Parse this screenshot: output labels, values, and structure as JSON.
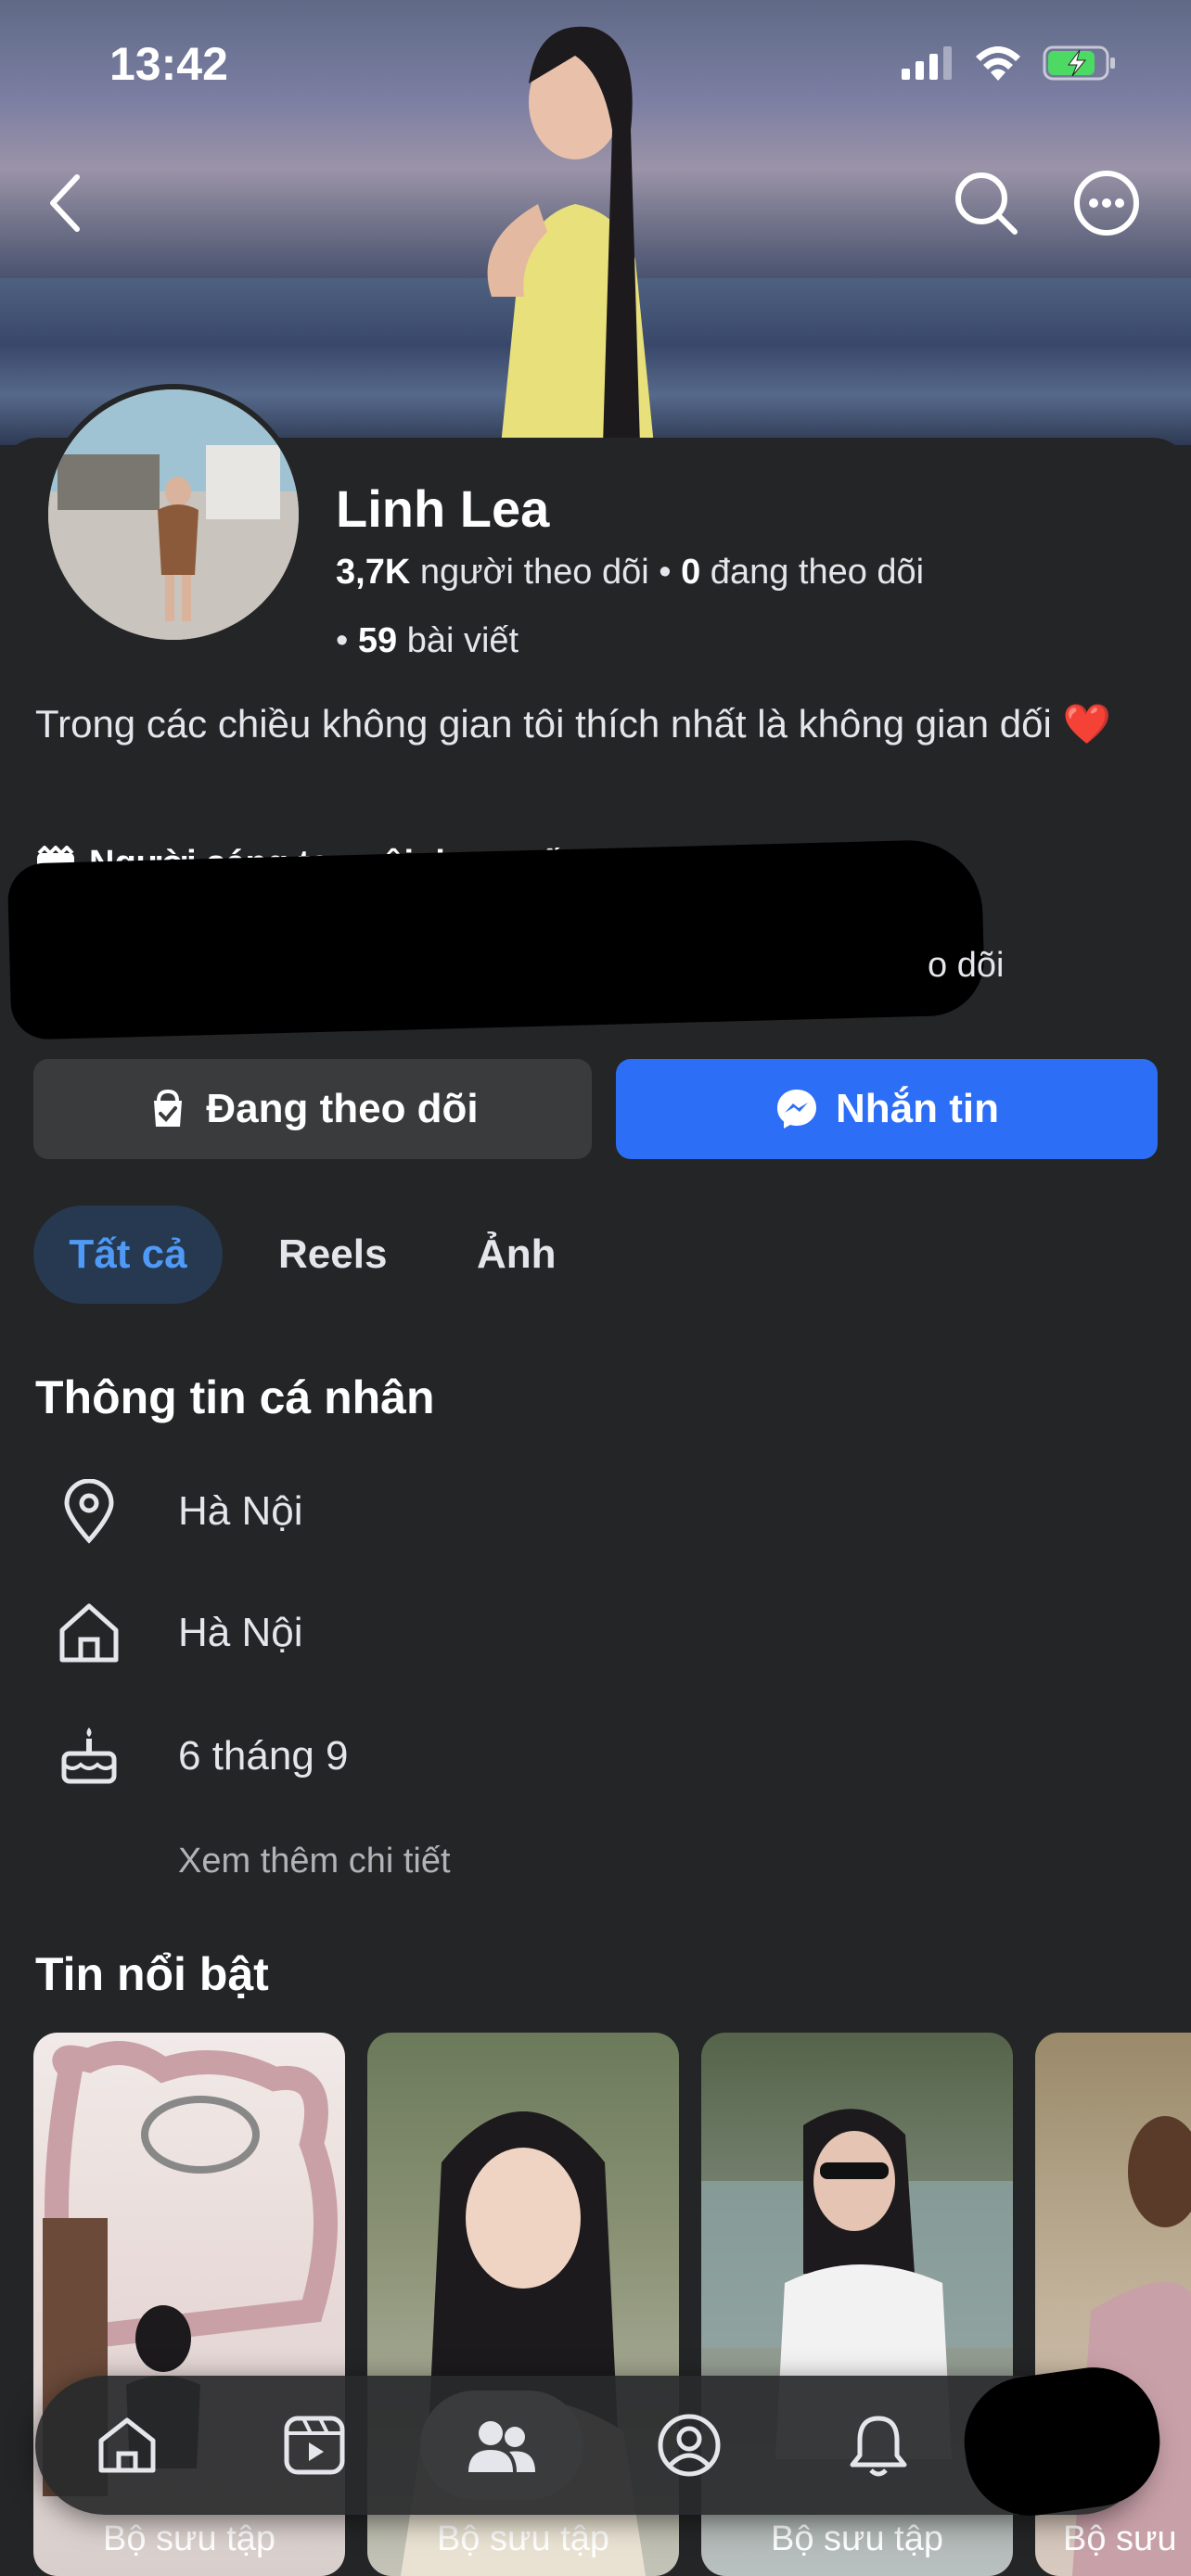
{
  "status": {
    "time": "13:42"
  },
  "profile": {
    "name": "Linh Lea",
    "followers_count": "3,7K",
    "followers_label": " người theo dõi • ",
    "following_count": "0",
    "following_label": " đang theo dõi",
    "posts_prefix": "• ",
    "posts_count": "59",
    "posts_label": " bài viết",
    "bio": "Trong các chiều không gian tôi thích nhất là không gian dối ❤️",
    "creator_label": "Người sáng tạo nội dung số",
    "follow_snippet": "o dõi"
  },
  "actions": {
    "following_label": "Đang theo dõi",
    "message_label": "Nhắn tin"
  },
  "tabs": [
    {
      "label": "Tất cả"
    },
    {
      "label": "Reels"
    },
    {
      "label": "Ảnh"
    }
  ],
  "info": {
    "title": "Thông tin cá nhân",
    "rows": [
      {
        "icon": "location-pin-icon",
        "text": "Hà Nội"
      },
      {
        "icon": "home-icon",
        "text": "Hà Nội"
      },
      {
        "icon": "birthday-cake-icon",
        "text": "6 tháng 9"
      }
    ],
    "see_more": "Xem thêm chi tiết"
  },
  "highlights": {
    "title": "Tin nổi bật",
    "items": [
      {
        "label": "Bộ sưu tập"
      },
      {
        "label": "Bộ sưu tập"
      },
      {
        "label": "Bộ sưu tập"
      },
      {
        "label": "Bộ sưu"
      }
    ]
  },
  "nav": [
    "home-icon",
    "video-icon",
    "friends-icon",
    "profile-icon",
    "bell-icon"
  ],
  "colors": {
    "accent": "#2d6ef7",
    "background": "#242526",
    "tab_active_bg": "#263951"
  }
}
